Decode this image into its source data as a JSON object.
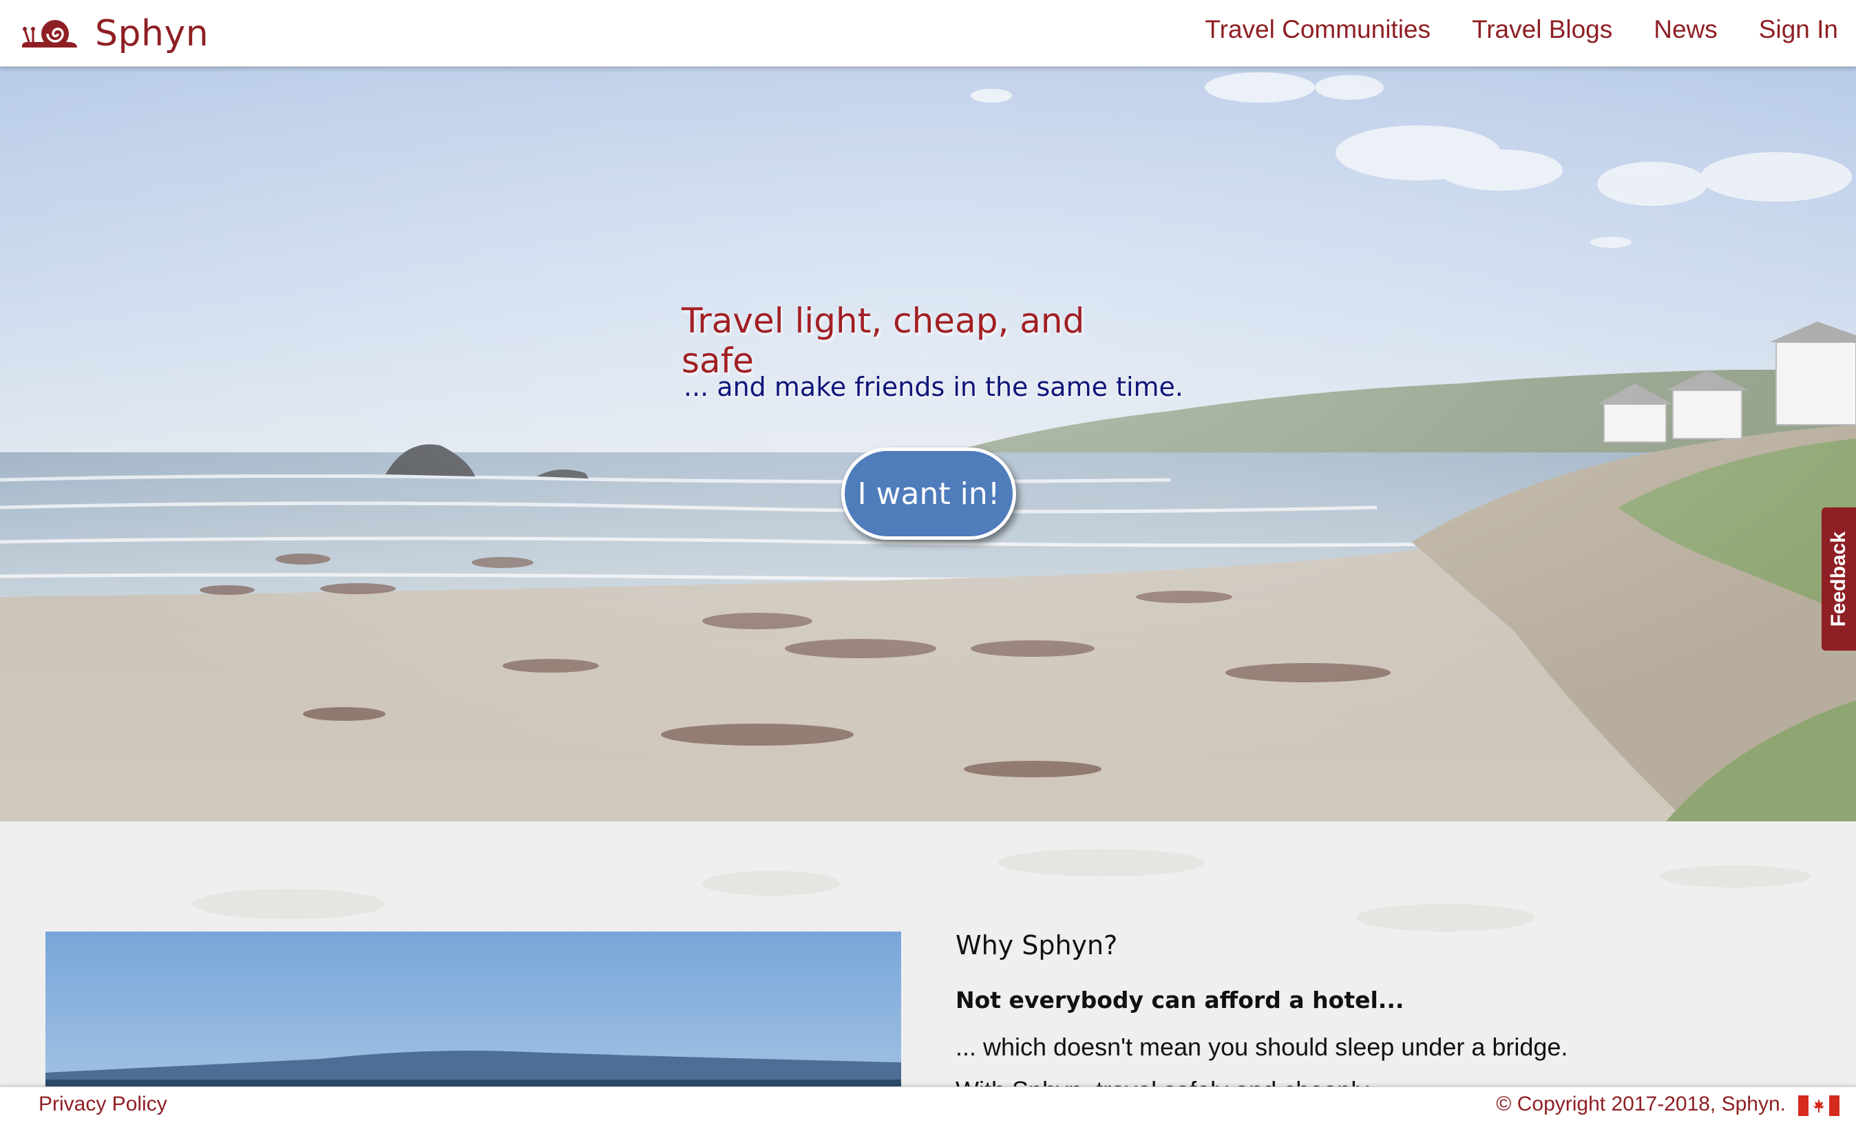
{
  "header": {
    "brand_name": "Sphyn",
    "logo_icon": "snail-icon",
    "nav": [
      {
        "label": "Travel Communities"
      },
      {
        "label": "Travel Blogs"
      },
      {
        "label": "News"
      },
      {
        "label": "Sign In"
      }
    ]
  },
  "hero": {
    "title": "Travel light, cheap, and safe",
    "subtitle": "... and make friends in the same time.",
    "cta_label": "I want in!"
  },
  "feedback_tab": {
    "label": "Feedback"
  },
  "why": {
    "heading": "Why Sphyn?",
    "subheading": "Not everybody can afford a hotel...",
    "text": "... which doesn't mean you should sleep under a bridge.",
    "cut_text": "With Sphyn, travel safely and cheaply"
  },
  "footer": {
    "privacy_label": "Privacy Policy",
    "copyright": "© Copyright 2017-2018, Sphyn.",
    "flag_icon": "canada-flag-icon"
  },
  "colors": {
    "brand": "#8e1f24",
    "hero_title": "#a11f23",
    "hero_subtitle": "#0f1579",
    "cta_background": "#4f7cbb",
    "feedback_background": "#8e1f24"
  }
}
